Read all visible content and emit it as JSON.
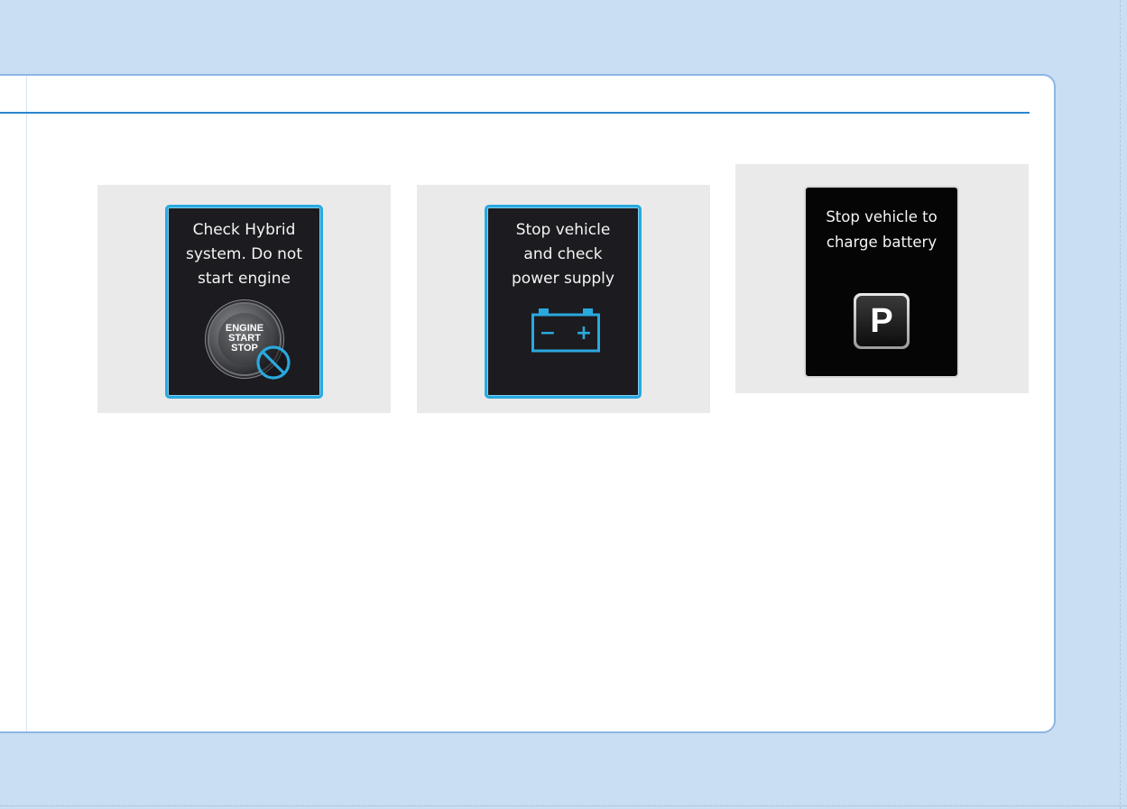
{
  "panels": [
    {
      "message": "Check Hybrid\nsystem. Do not\nstart engine",
      "icon": "engine-start-stop-prohibited-icon",
      "button_text": [
        "ENGINE",
        "START",
        "STOP"
      ]
    },
    {
      "message": "Stop vehicle\nand check\npower supply",
      "icon": "battery-icon",
      "battery_signs": [
        "−",
        "+"
      ]
    },
    {
      "message": "Stop vehicle to\ncharge battery",
      "icon": "park-p-icon",
      "p_label": "P"
    }
  ],
  "colors": {
    "page_background": "#c9def3",
    "card_border": "#8db6e4",
    "rule": "#2a86d0",
    "screen_border": "#2aa9df",
    "battery_icon": "#2aa9df",
    "prohibit_icon": "#2aa9df"
  }
}
